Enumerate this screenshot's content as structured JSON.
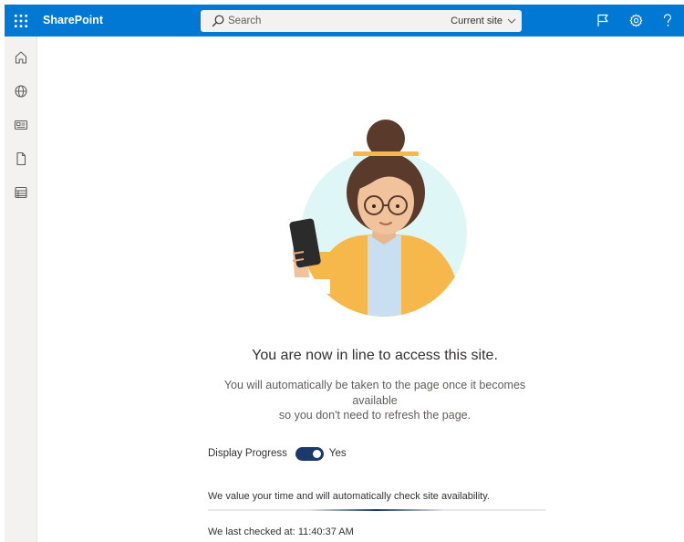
{
  "app": {
    "name": "SharePoint"
  },
  "search": {
    "placeholder": "Search",
    "scope": "Current site"
  },
  "rail": {
    "items": [
      "home",
      "sites",
      "news",
      "files",
      "lists"
    ]
  },
  "queue": {
    "headline": "You are now in line to access this site.",
    "description_line1": "You will automatically be taken to the page once it becomes available",
    "description_line2": "so you don't need to refresh the page.",
    "display_progress_label": "Display Progress",
    "display_progress_enabled": true,
    "display_progress_state": "Yes",
    "info_text": "We value your time and will automatically check site availability.",
    "progress_fraction": 0.4,
    "last_checked": "We last checked at: 11:40:37 AM"
  },
  "colors": {
    "suite_bar": "#0078d4",
    "rail_bg": "#f3f2f1",
    "toggle_on": "#1b3a6b",
    "illustration_circle": "#dff6f6",
    "sweater": "#f7b84b"
  }
}
